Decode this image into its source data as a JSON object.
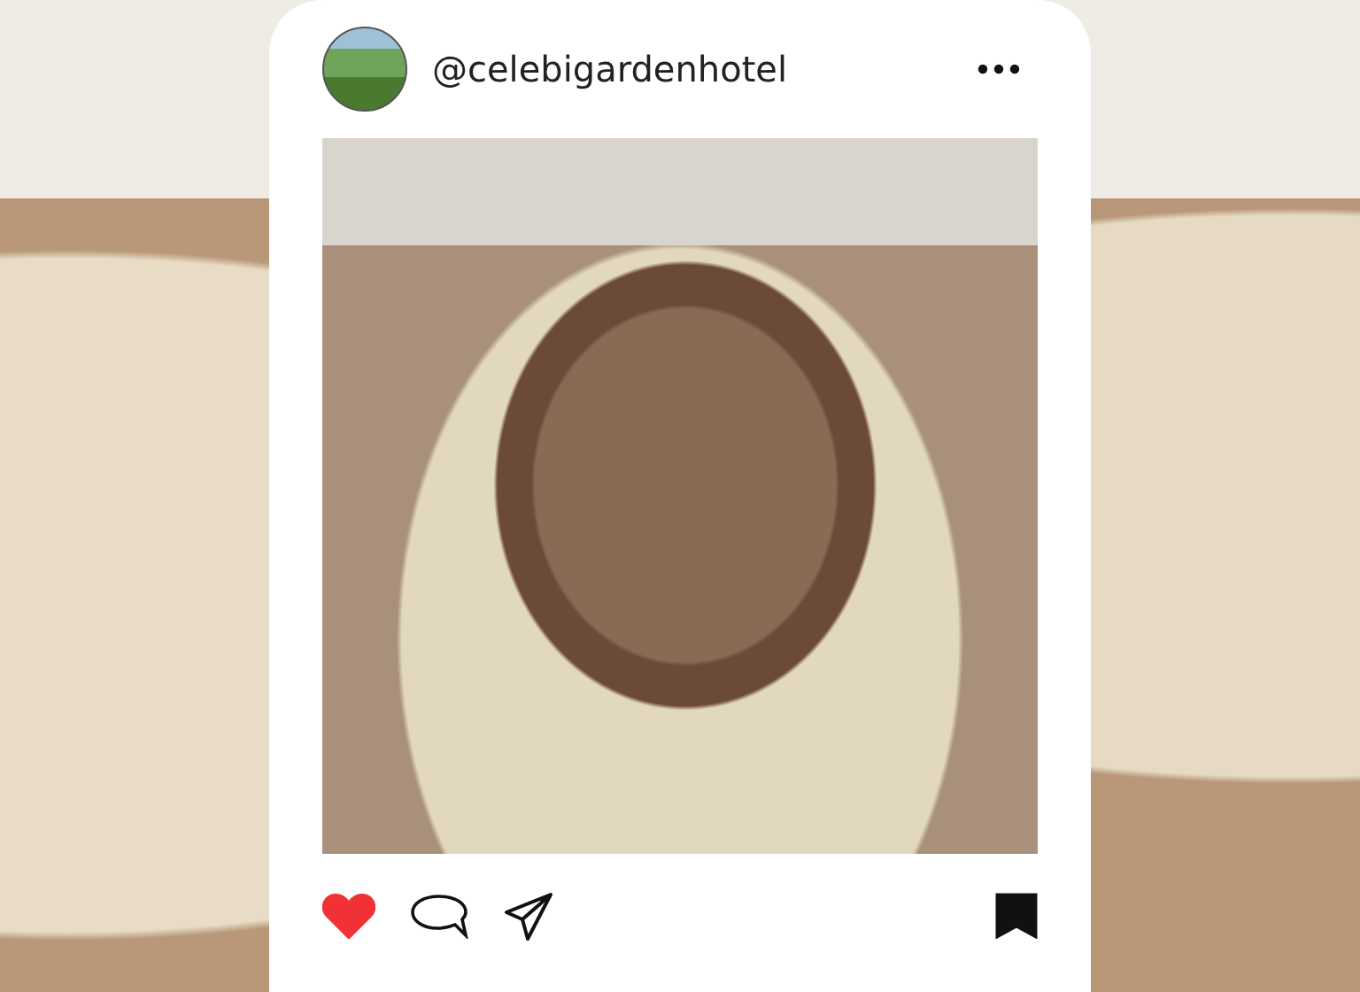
{
  "post": {
    "username": "@celebigardenhotel",
    "liked": true,
    "saved": true
  }
}
